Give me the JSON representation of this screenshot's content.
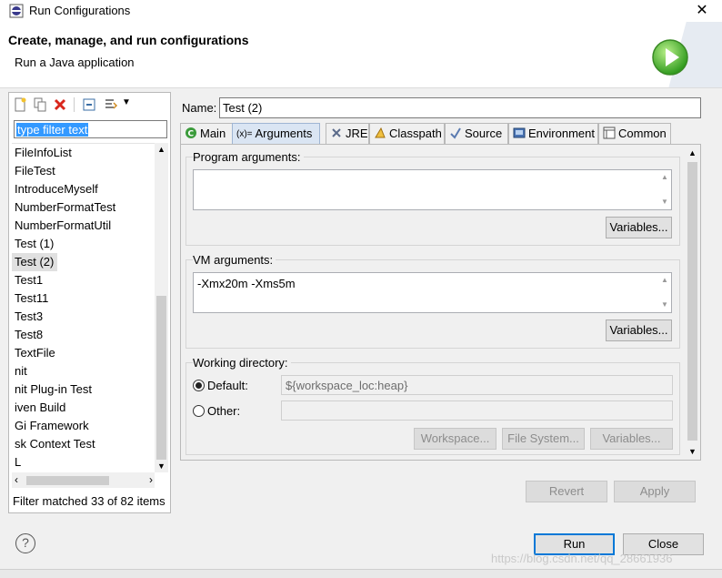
{
  "window": {
    "title": "Run Configurations"
  },
  "header": {
    "title": "Create, manage, and run configurations",
    "subtitle": "Run a Java application"
  },
  "left": {
    "filter_text": "type filter text",
    "items": [
      {
        "label": "FileInfoList",
        "selected": false
      },
      {
        "label": "FileTest",
        "selected": false
      },
      {
        "label": "IntroduceMyself",
        "selected": false
      },
      {
        "label": "NumberFormatTest",
        "selected": false
      },
      {
        "label": "NumberFormatUtil",
        "selected": false
      },
      {
        "label": "Test (1)",
        "selected": false
      },
      {
        "label": "Test (2)",
        "selected": true
      },
      {
        "label": "Test1",
        "selected": false
      },
      {
        "label": "Test11",
        "selected": false
      },
      {
        "label": "Test3",
        "selected": false
      },
      {
        "label": "Test8",
        "selected": false
      },
      {
        "label": "TextFile",
        "selected": false
      },
      {
        "label": "nit",
        "selected": false
      },
      {
        "label": "nit Plug-in Test",
        "selected": false
      },
      {
        "label": "iven Build",
        "selected": false
      },
      {
        "label": "Gi Framework",
        "selected": false
      },
      {
        "label": "sk Context Test",
        "selected": false
      },
      {
        "label": "L",
        "selected": false
      }
    ],
    "status": "Filter matched 33 of 82 items",
    "vscroll_position": 0.55
  },
  "name": {
    "label": "Name:",
    "value": "Test (2)"
  },
  "tabs": [
    {
      "label": "Main",
      "icon": "main-tab-icon",
      "active": false
    },
    {
      "label": "Arguments",
      "icon": "arguments-tab-icon",
      "active": true
    },
    {
      "label": "JRE",
      "icon": "jre-tab-icon",
      "active": false
    },
    {
      "label": "Classpath",
      "icon": "classpath-tab-icon",
      "active": false
    },
    {
      "label": "Source",
      "icon": "source-tab-icon",
      "active": false
    },
    {
      "label": "Environment",
      "icon": "environment-tab-icon",
      "active": false
    },
    {
      "label": "Common",
      "icon": "common-tab-icon",
      "active": false
    }
  ],
  "arguments": {
    "program_label": "Program arguments:",
    "program_value": "",
    "variables_label": "Variables...",
    "vm_label": "VM arguments:",
    "vm_value": "-Xmx20m -Xms5m",
    "working_dir_label": "Working directory:",
    "default_label": "Default:",
    "default_value": "${workspace_loc:heap}",
    "other_label": "Other:",
    "other_value": "",
    "workspace_button": "Workspace...",
    "filesystem_button": "File System...",
    "variables_button": "Variables..."
  },
  "actions": {
    "revert": "Revert",
    "apply": "Apply",
    "run": "Run",
    "close": "Close"
  },
  "watermark": "https://blog.csdn.net/qq_28661936",
  "colors": {
    "accent": "#0078d7",
    "selection": "#3399ff",
    "tab_active": "#dae5f3"
  }
}
